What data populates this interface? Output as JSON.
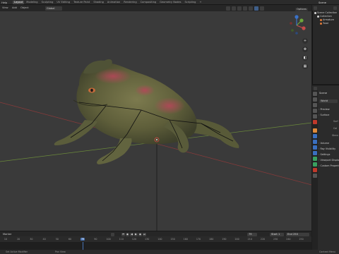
{
  "topbar": {
    "menu": "Help",
    "workspaces": [
      "Layout",
      "Modeling",
      "Sculpting",
      "UV Editing",
      "Texture Paint",
      "Shading",
      "Animation",
      "Rendering",
      "Compositing",
      "Geometry Nodes",
      "Scripting",
      "+"
    ],
    "active_workspace": "Layout",
    "scene": "Scene"
  },
  "viewport_header": {
    "view": "View",
    "add": "Add",
    "object": "Object",
    "mode": "Global",
    "options": "Options"
  },
  "navigation": {
    "gizmo_axes": [
      "X",
      "Y",
      "Z"
    ],
    "zoom_icon": "zoom-icon",
    "pan_icon": "pan-icon",
    "camera_icon": "camera-icon",
    "grid_icon": "grid-icon"
  },
  "outliner": {
    "rows": [
      "Scene Collection",
      "Collection",
      "Armature",
      "Toad"
    ],
    "colors": {
      "collection": "#d8d8d8",
      "armature": "#e07a3a",
      "mesh": "#e07a3a"
    }
  },
  "properties": {
    "header": "Scene",
    "world_field": "World",
    "panels": [
      "Preview",
      "Surface",
      "Volume",
      "Ray Visibility",
      "Settings",
      "Viewport Display",
      "Custom Properties"
    ],
    "surface_sub": [
      "Surf",
      "Col",
      "Stren"
    ]
  },
  "timeline": {
    "label": "Marker",
    "current_frame": "79",
    "start_label": "Start",
    "start": "1",
    "end_label": "End",
    "end": "250",
    "ticks": [
      "10",
      "20",
      "30",
      "40",
      "50",
      "60",
      "79",
      "90",
      "100",
      "110",
      "120",
      "130",
      "140",
      "150",
      "160",
      "170",
      "180",
      "190",
      "200",
      "210",
      "220",
      "230",
      "240",
      "250",
      "260"
    ],
    "current_tick_index": 6
  },
  "statusbar": {
    "left": "Set Active Modifier",
    "mid": "Pan View",
    "right": "Context Menu"
  }
}
